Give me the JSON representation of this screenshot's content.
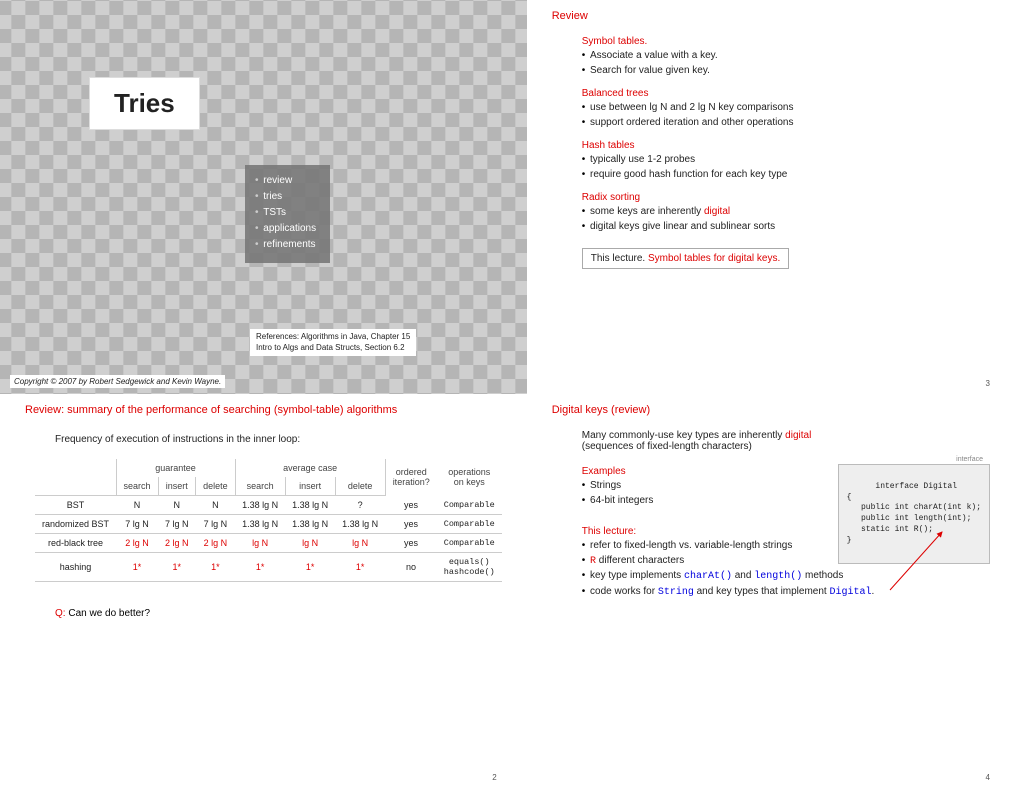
{
  "slide1": {
    "title": "Tries",
    "toc": [
      "review",
      "tries",
      "TSTs",
      "applications",
      "refinements"
    ],
    "refs": [
      "References:  Algorithms in Java, Chapter 15",
      "Intro to Algs and Data Structs, Section 6.2"
    ],
    "copyright": "Copyright © 2007 by Robert Sedgewick and Kevin Wayne."
  },
  "slide3": {
    "title": "Review",
    "sections": [
      {
        "head": "Symbol tables.",
        "items": [
          "Associate a value with a key.",
          "Search for value given key."
        ]
      },
      {
        "head": "Balanced trees",
        "items": [
          "use between lg N and 2 lg N key comparisons",
          "support ordered iteration and other operations"
        ]
      },
      {
        "head": "Hash tables",
        "items": [
          "typically use 1-2 probes",
          "require good hash function for each key type"
        ]
      },
      {
        "head": "Radix sorting",
        "items_html": [
          "some keys are inherently <span class='red'>digital</span>",
          "digital keys give linear and sublinear sorts"
        ]
      }
    ],
    "footer_pre": "This lecture.  ",
    "footer_red": "Symbol tables for digital keys.",
    "pageno": "3"
  },
  "slide2": {
    "title": "Review: summary of the performance of searching (symbol-table) algorithms",
    "subtitle": "Frequency of execution of instructions in the inner loop:",
    "col_group_labels": [
      "guarantee",
      "average case",
      "ordered iteration?",
      "operations on keys"
    ],
    "sub_cols": [
      "search",
      "insert",
      "delete",
      "search",
      "insert",
      "delete"
    ],
    "rows": [
      {
        "name": "BST",
        "g": [
          "N",
          "N",
          "N"
        ],
        "a": [
          "1.38 lg N",
          "1.38 lg N",
          "?"
        ],
        "ord": "yes",
        "ops": "Comparable"
      },
      {
        "name": "randomized BST",
        "g": [
          "7 lg N",
          "7 lg N",
          "7 lg N"
        ],
        "a": [
          "1.38 lg N",
          "1.38 lg N",
          "1.38 lg N"
        ],
        "ord": "yes",
        "ops": "Comparable"
      },
      {
        "name": "red-black tree",
        "g": [
          "2 lg N",
          "2 lg N",
          "2 lg N"
        ],
        "a": [
          "lg N",
          "lg N",
          "lg N"
        ],
        "ord": "yes",
        "ops": "Comparable",
        "red": true
      },
      {
        "name": "hashing",
        "g": [
          "1*",
          "1*",
          "1*"
        ],
        "a": [
          "1*",
          "1*",
          "1*"
        ],
        "ord": "no",
        "ops": "equals()\nhashcode()",
        "red": true
      }
    ],
    "question_pre": "Q: ",
    "question": "Can we do better?",
    "pageno": "2"
  },
  "slide4": {
    "title": "Digital keys (review)",
    "intro_plain": "Many commonly-use key types are inherently ",
    "intro_red": "digital",
    "intro_line2": "(sequences of fixed-length characters)",
    "examples_head": "Examples",
    "examples": [
      "Strings",
      "64-bit integers"
    ],
    "lecture_head": "This lecture:",
    "lecture_items_html": [
      "refer to fixed-length vs. variable-length strings",
      "<code class='inline red'>R</code> different characters",
      "key type implements <code class='inline blue'>charAt()</code> and <code class='inline blue'>length()</code> methods",
      "code works for <code class='inline blue'>String</code> and key types that implement <code class='inline blue'>Digital</code>."
    ],
    "code_label": "interface",
    "code": "interface Digital\n{\n   public int charAt(int k);\n   public int length(int);\n   static int R();\n}",
    "pageno": "4"
  }
}
